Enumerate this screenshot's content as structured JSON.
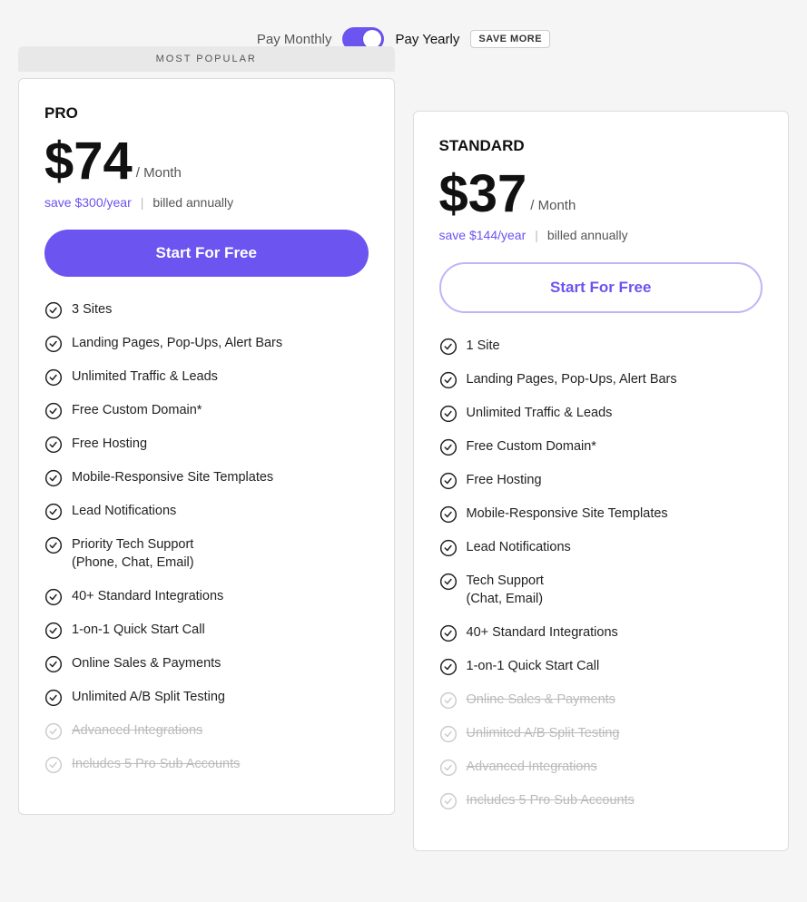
{
  "billing": {
    "monthly_label": "Pay Monthly",
    "yearly_label": "Pay Yearly",
    "save_badge": "SAVE MORE"
  },
  "pro": {
    "badge": "MOST POPULAR",
    "name": "PRO",
    "currency": "$",
    "price": "74",
    "period": "/ Month",
    "savings": "save $300/year",
    "billed": "billed annually",
    "cta": "Start For Free",
    "features": [
      {
        "text": "3 Sites",
        "active": true
      },
      {
        "text": "Landing Pages, Pop-Ups, Alert Bars",
        "active": true
      },
      {
        "text": "Unlimited Traffic & Leads",
        "active": true
      },
      {
        "text": "Free Custom Domain*",
        "active": true
      },
      {
        "text": "Free Hosting",
        "active": true
      },
      {
        "text": "Mobile-Responsive Site Templates",
        "active": true
      },
      {
        "text": "Lead Notifications",
        "active": true
      },
      {
        "text": "Priority Tech Support\n(Phone, Chat, Email)",
        "active": true
      },
      {
        "text": "40+ Standard Integrations",
        "active": true
      },
      {
        "text": "1-on-1 Quick Start Call",
        "active": true
      },
      {
        "text": "Online Sales & Payments",
        "active": true
      },
      {
        "text": "Unlimited A/B Split Testing",
        "active": true
      },
      {
        "text": "Advanced Integrations",
        "active": false
      },
      {
        "text": "Includes 5 Pro Sub Accounts",
        "active": false
      }
    ]
  },
  "standard": {
    "name": "STANDARD",
    "currency": "$",
    "price": "37",
    "period": "/ Month",
    "savings": "save $144/year",
    "billed": "billed annually",
    "cta": "Start For Free",
    "features": [
      {
        "text": "1 Site",
        "active": true
      },
      {
        "text": "Landing Pages, Pop-Ups, Alert Bars",
        "active": true
      },
      {
        "text": "Unlimited Traffic & Leads",
        "active": true
      },
      {
        "text": "Free Custom Domain*",
        "active": true
      },
      {
        "text": "Free Hosting",
        "active": true
      },
      {
        "text": "Mobile-Responsive Site Templates",
        "active": true
      },
      {
        "text": "Lead Notifications",
        "active": true
      },
      {
        "text": "Tech Support\n(Chat, Email)",
        "active": true
      },
      {
        "text": "40+ Standard Integrations",
        "active": true
      },
      {
        "text": "1-on-1 Quick Start Call",
        "active": true
      },
      {
        "text": "Online Sales & Payments",
        "active": false
      },
      {
        "text": "Unlimited A/B Split Testing",
        "active": false
      },
      {
        "text": "Advanced Integrations",
        "active": false
      },
      {
        "text": "Includes 5 Pro Sub Accounts",
        "active": false
      }
    ]
  }
}
